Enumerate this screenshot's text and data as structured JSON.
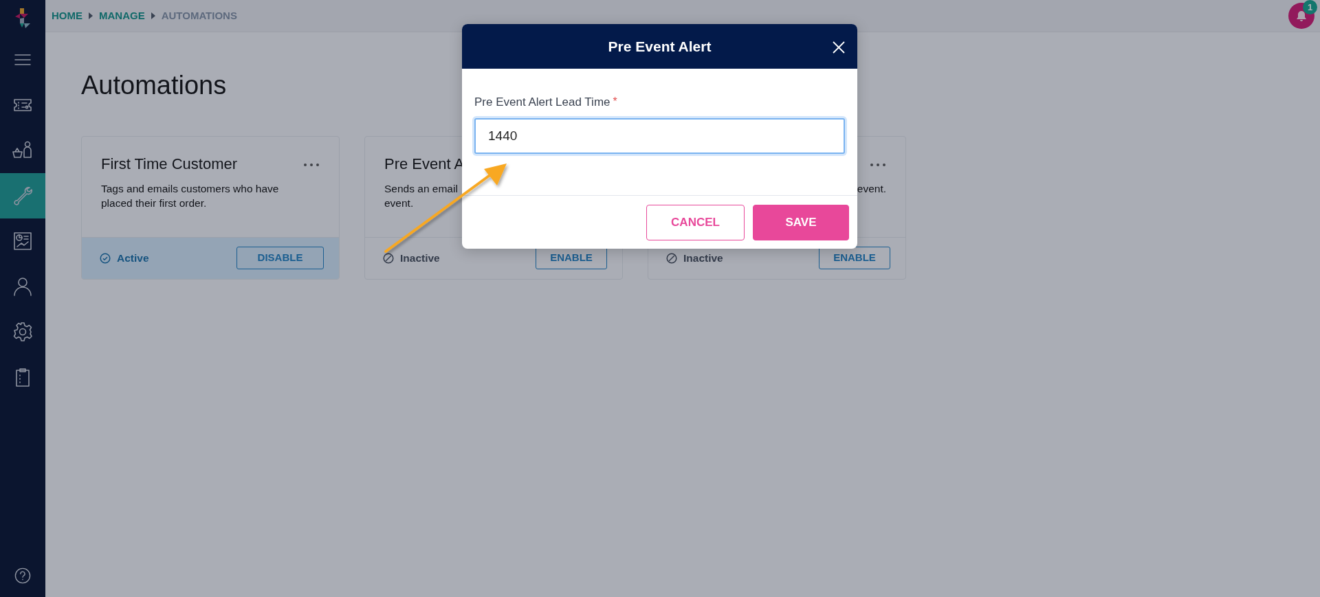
{
  "sidebar": {
    "items": [
      {
        "kind": "menu",
        "selected": false
      },
      {
        "kind": "ticket",
        "selected": false
      },
      {
        "kind": "shop",
        "selected": false
      },
      {
        "kind": "wrench",
        "selected": true
      },
      {
        "kind": "report",
        "selected": false
      },
      {
        "kind": "user",
        "selected": false
      },
      {
        "kind": "gear",
        "selected": false
      },
      {
        "kind": "clipboard",
        "selected": false
      }
    ]
  },
  "breadcrumb": [
    {
      "label": "HOME",
      "current": false
    },
    {
      "label": "MANAGE",
      "current": false
    },
    {
      "label": "AUTOMATIONS",
      "current": true
    }
  ],
  "notifications": {
    "count": "1"
  },
  "page_title": "Automations",
  "cards": [
    {
      "title": "First Time Customer",
      "menu": true,
      "description": "Tags and emails customers who have\nplaced their first order.",
      "desc_right": false,
      "active": true,
      "status": "Active",
      "action": "DISABLE"
    },
    {
      "title": "Pre Event A",
      "menu": false,
      "description": "Sends an email\nevent.",
      "desc_right": false,
      "active": false,
      "status": "Inactive",
      "action": "ENABLE"
    },
    {
      "menu": true,
      "description": "event.",
      "desc_right": true,
      "active": false,
      "status": "Inactive",
      "action": "ENABLE"
    }
  ],
  "modal": {
    "title": "Pre Event Alert",
    "field": {
      "label": "Pre Event Alert Lead Time",
      "required_mark": "*",
      "value": "1440",
      "focused": true
    },
    "buttons": [
      {
        "label": "CANCEL",
        "kind": "secondary"
      },
      {
        "label": "SAVE",
        "kind": "primary"
      }
    ]
  }
}
